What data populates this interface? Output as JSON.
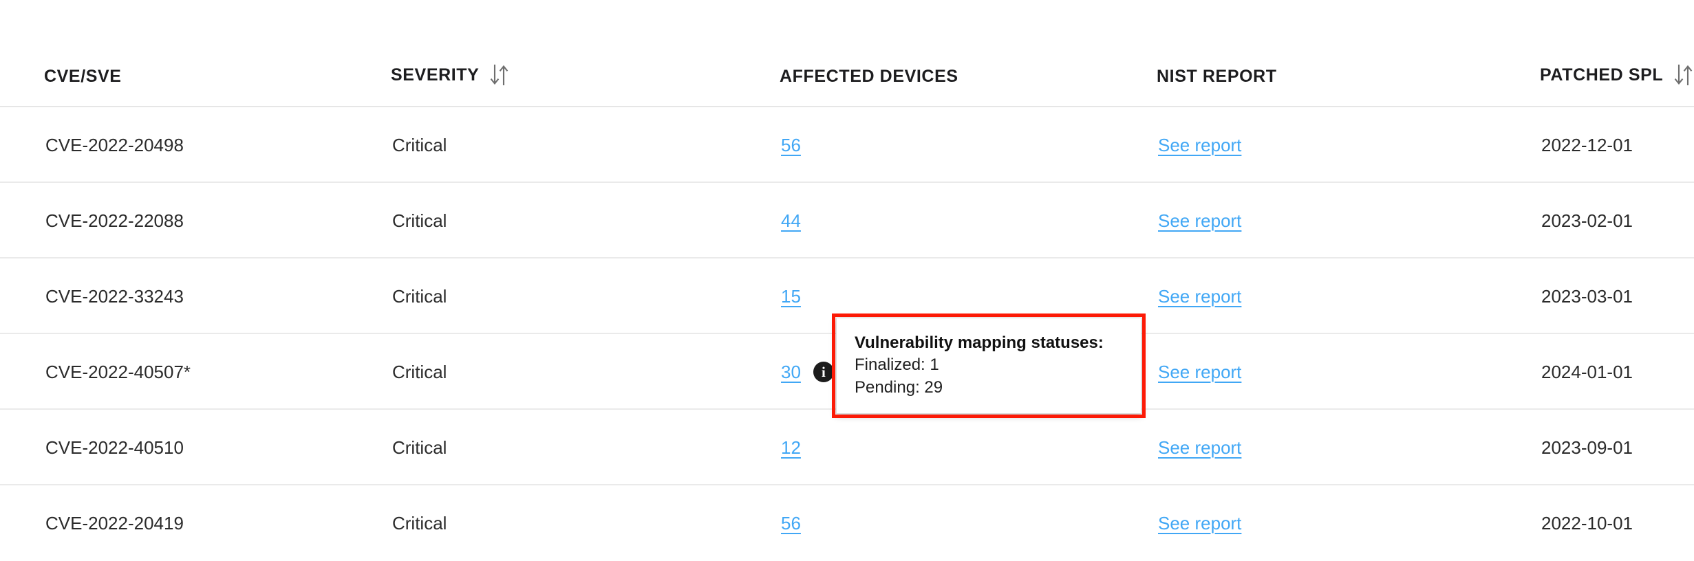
{
  "table": {
    "columns": [
      {
        "key": "cve",
        "label": "CVE/SVE",
        "sortable": false,
        "sort_icon": "sort-arrows-icon"
      },
      {
        "key": "severity",
        "label": "SEVERITY",
        "sortable": true,
        "sort_icon": "sort-arrows-icon"
      },
      {
        "key": "devices",
        "label": "AFFECTED DEVICES",
        "sortable": false,
        "sort_icon": "sort-arrows-icon"
      },
      {
        "key": "nist",
        "label": "NIST REPORT",
        "sortable": false,
        "sort_icon": "sort-arrows-icon"
      },
      {
        "key": "patched",
        "label": "PATCHED SPL",
        "sortable": true,
        "sort_icon": "sort-arrows-icon"
      }
    ],
    "rows": [
      {
        "cve": "CVE-2022-20498",
        "severity": "Critical",
        "devices": "56",
        "has_info_icon": false,
        "nist": "See report",
        "patched": "2022-12-01"
      },
      {
        "cve": "CVE-2022-22088",
        "severity": "Critical",
        "devices": "44",
        "has_info_icon": false,
        "nist": "See report",
        "patched": "2023-02-01"
      },
      {
        "cve": "CVE-2022-33243",
        "severity": "Critical",
        "devices": "15",
        "has_info_icon": false,
        "nist": "See report",
        "patched": "2023-03-01"
      },
      {
        "cve": "CVE-2022-40507*",
        "severity": "Critical",
        "devices": "30",
        "has_info_icon": true,
        "info_icon_name": "info-icon",
        "info_icon_glyph": "i",
        "nist": "See report",
        "patched": "2024-01-01"
      },
      {
        "cve": "CVE-2022-40510",
        "severity": "Critical",
        "devices": "12",
        "has_info_icon": false,
        "nist": "See report",
        "patched": "2023-09-01"
      },
      {
        "cve": "CVE-2022-20419",
        "severity": "Critical",
        "devices": "56",
        "has_info_icon": false,
        "nist": "See report",
        "patched": "2022-10-01"
      }
    ]
  },
  "tooltip": {
    "title": "Vulnerability mapping statuses:",
    "finalized": "Finalized: 1",
    "pending": "Pending: 29",
    "highlight_color": "#fc1a06"
  },
  "colors": {
    "link": "#41a7f5",
    "text": "#2b2b2b",
    "header_text": "#1d1d1f",
    "row_divider": "#eaeaea",
    "header_divider": "#e6e6e6",
    "background": "#ffffff",
    "info_icon_bg": "#1c1c1c",
    "sort_icon": "#6e6e6e"
  }
}
